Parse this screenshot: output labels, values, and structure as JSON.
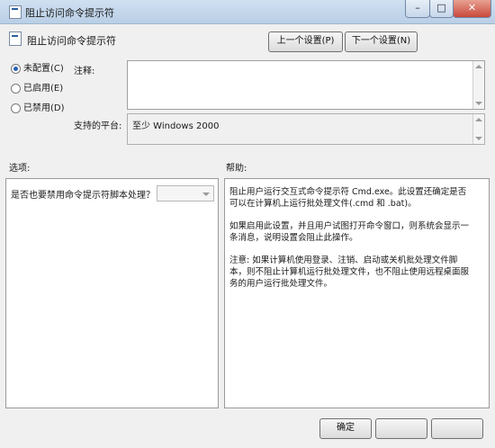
{
  "window": {
    "title": "阻止访问命令提示符",
    "controls": {
      "minimize": "–",
      "maximize": "□",
      "close": "✕"
    }
  },
  "header": {
    "title": "阻止访问命令提示符",
    "prev_button": "上一个设置(P)",
    "next_button": "下一个设置(N)"
  },
  "state_options": [
    {
      "label": "未配置(C)",
      "checked": true
    },
    {
      "label": "已启用(E)",
      "checked": false
    },
    {
      "label": "已禁用(D)",
      "checked": false
    }
  ],
  "comment": {
    "label": "注释:",
    "value": ""
  },
  "platform": {
    "label": "支持的平台:",
    "value": "至少 Windows 2000"
  },
  "options": {
    "label": "选项:",
    "question": "是否也要禁用命令提示符脚本处理？",
    "dropdown_value": ""
  },
  "help": {
    "label": "帮助:",
    "paragraphs": [
      "阻止用户运行交互式命令提示符 Cmd.exe。此设置还确定是否可以在计算机上运行批处理文件(.cmd 和 .bat)。",
      "如果启用此设置，并且用户试图打开命令窗口，则系统会显示一条消息，说明设置会阻止此操作。",
      "注意: 如果计算机使用登录、注销、启动或关机批处理文件脚本，则不阻止计算机运行批处理文件，也不阻止使用远程桌面服务的用户运行批处理文件。"
    ]
  },
  "footer": {
    "ok": "确定",
    "cancel": "",
    "apply": ""
  }
}
